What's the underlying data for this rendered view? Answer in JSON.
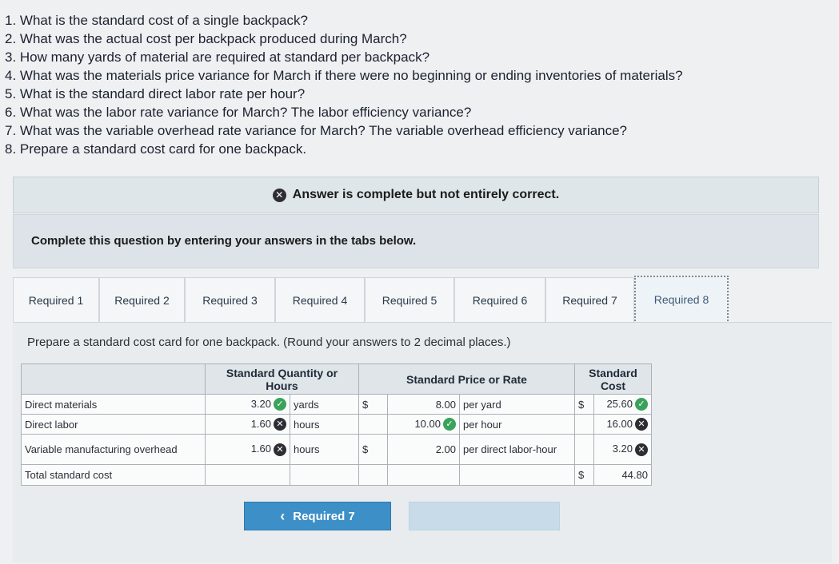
{
  "questions": [
    "1. What is the standard cost of a single backpack?",
    "2. What was the actual cost per backpack produced during March?",
    "3. How many yards of material are required at standard per backpack?",
    "4. What was the materials price variance for March if there were no beginning or ending inventories of materials?",
    "5. What is the standard direct labor rate per hour?",
    "6. What was the labor rate variance for March? The labor efficiency variance?",
    "7. What was the variable overhead rate variance for March? The variable overhead efficiency variance?",
    "8. Prepare a standard cost card for one backpack."
  ],
  "banner": {
    "text": "Answer is complete but not entirely correct.",
    "icon": "x-circle-icon"
  },
  "instruction": "Complete this question by entering your answers in the tabs below.",
  "tabs": [
    "Required 1",
    "Required 2",
    "Required 3",
    "Required 4",
    "Required 5",
    "Required 6",
    "Required 7",
    "Required 8"
  ],
  "active_tab": "Required 8",
  "prompt": "Prepare a standard cost card for one backpack. (Round your answers to 2 decimal places.)",
  "table": {
    "headers": {
      "qty": "Standard Quantity or Hours",
      "price": "Standard Price or Rate",
      "cost": "Standard Cost"
    },
    "rows": [
      {
        "label": "Direct materials",
        "qty": "3.20",
        "qty_status": "correct",
        "qty_unit": "yards",
        "dollar": "$",
        "price": "8.00",
        "price_status": "",
        "rate_unit": "per yard",
        "cost_dollar": "$",
        "cost": "25.60",
        "cost_status": "correct"
      },
      {
        "label": "Direct labor",
        "qty": "1.60",
        "qty_status": "incorrect",
        "qty_unit": "hours",
        "dollar": "",
        "price": "10.00",
        "price_status": "correct",
        "rate_unit": "per hour",
        "cost_dollar": "",
        "cost": "16.00",
        "cost_status": "incorrect"
      },
      {
        "label": "Variable manufacturing overhead",
        "qty": "1.60",
        "qty_status": "incorrect",
        "qty_unit": "hours",
        "dollar": "$",
        "price": "2.00",
        "price_status": "",
        "rate_unit": "per direct labor-hour",
        "cost_dollar": "",
        "cost": "3.20",
        "cost_status": "incorrect"
      }
    ],
    "total": {
      "label": "Total standard cost",
      "dollar": "$",
      "value": "44.80"
    }
  },
  "buttons": {
    "prev": "Required 7",
    "prev_glyph": "‹"
  }
}
